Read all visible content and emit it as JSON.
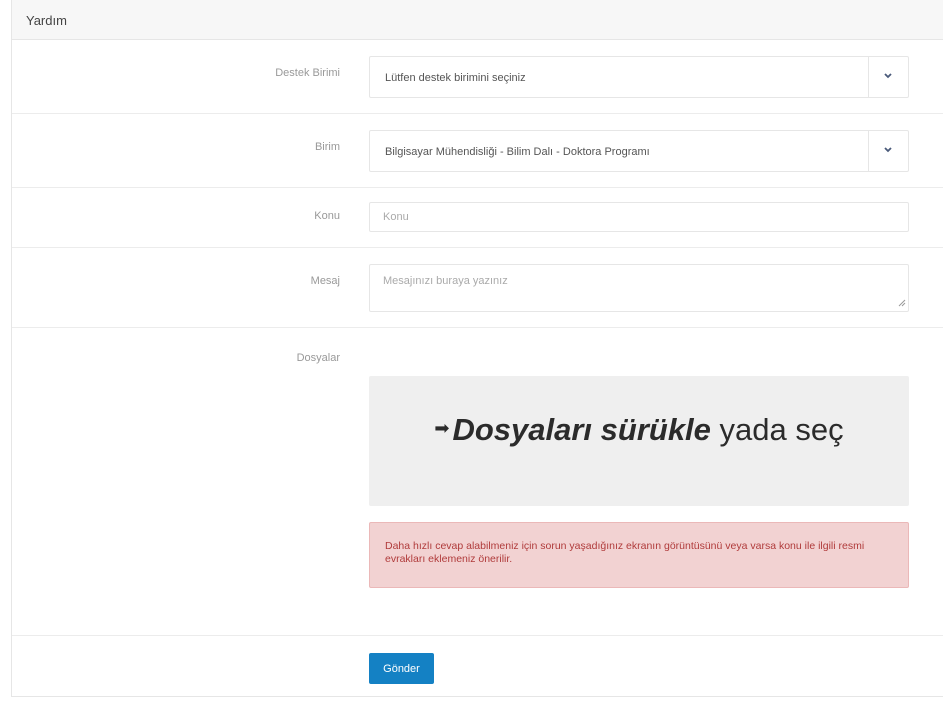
{
  "header": {
    "title": "Yardım"
  },
  "form": {
    "unit": {
      "label": "Destek Birimi",
      "value": "Lütfen destek birimini seçiniz"
    },
    "department": {
      "label": "Birim",
      "value": "Bilgisayar Mühendisliği - Bilim Dalı - Doktora Programı"
    },
    "subject": {
      "label": "Konu",
      "placeholder": "Konu"
    },
    "message": {
      "label": "Mesaj",
      "placeholder": "Mesajınızı buraya yazınız"
    },
    "files": {
      "label": "Dosyalar",
      "drop_bold": "Dosyaları sürükle",
      "drop_rest": "yada seç"
    },
    "alert": "Daha hızlı cevap alabilmeniz için sorun yaşadığınız ekranın görüntüsünü veya varsa konu ile ilgili resmi evrakları eklemeniz önerilir.",
    "submit_label": "Gönder"
  },
  "colors": {
    "primary_button": "#1481c4",
    "alert_bg": "#f2d2d2",
    "alert_text": "#b03b3b",
    "dropzone_bg": "#efefef"
  }
}
